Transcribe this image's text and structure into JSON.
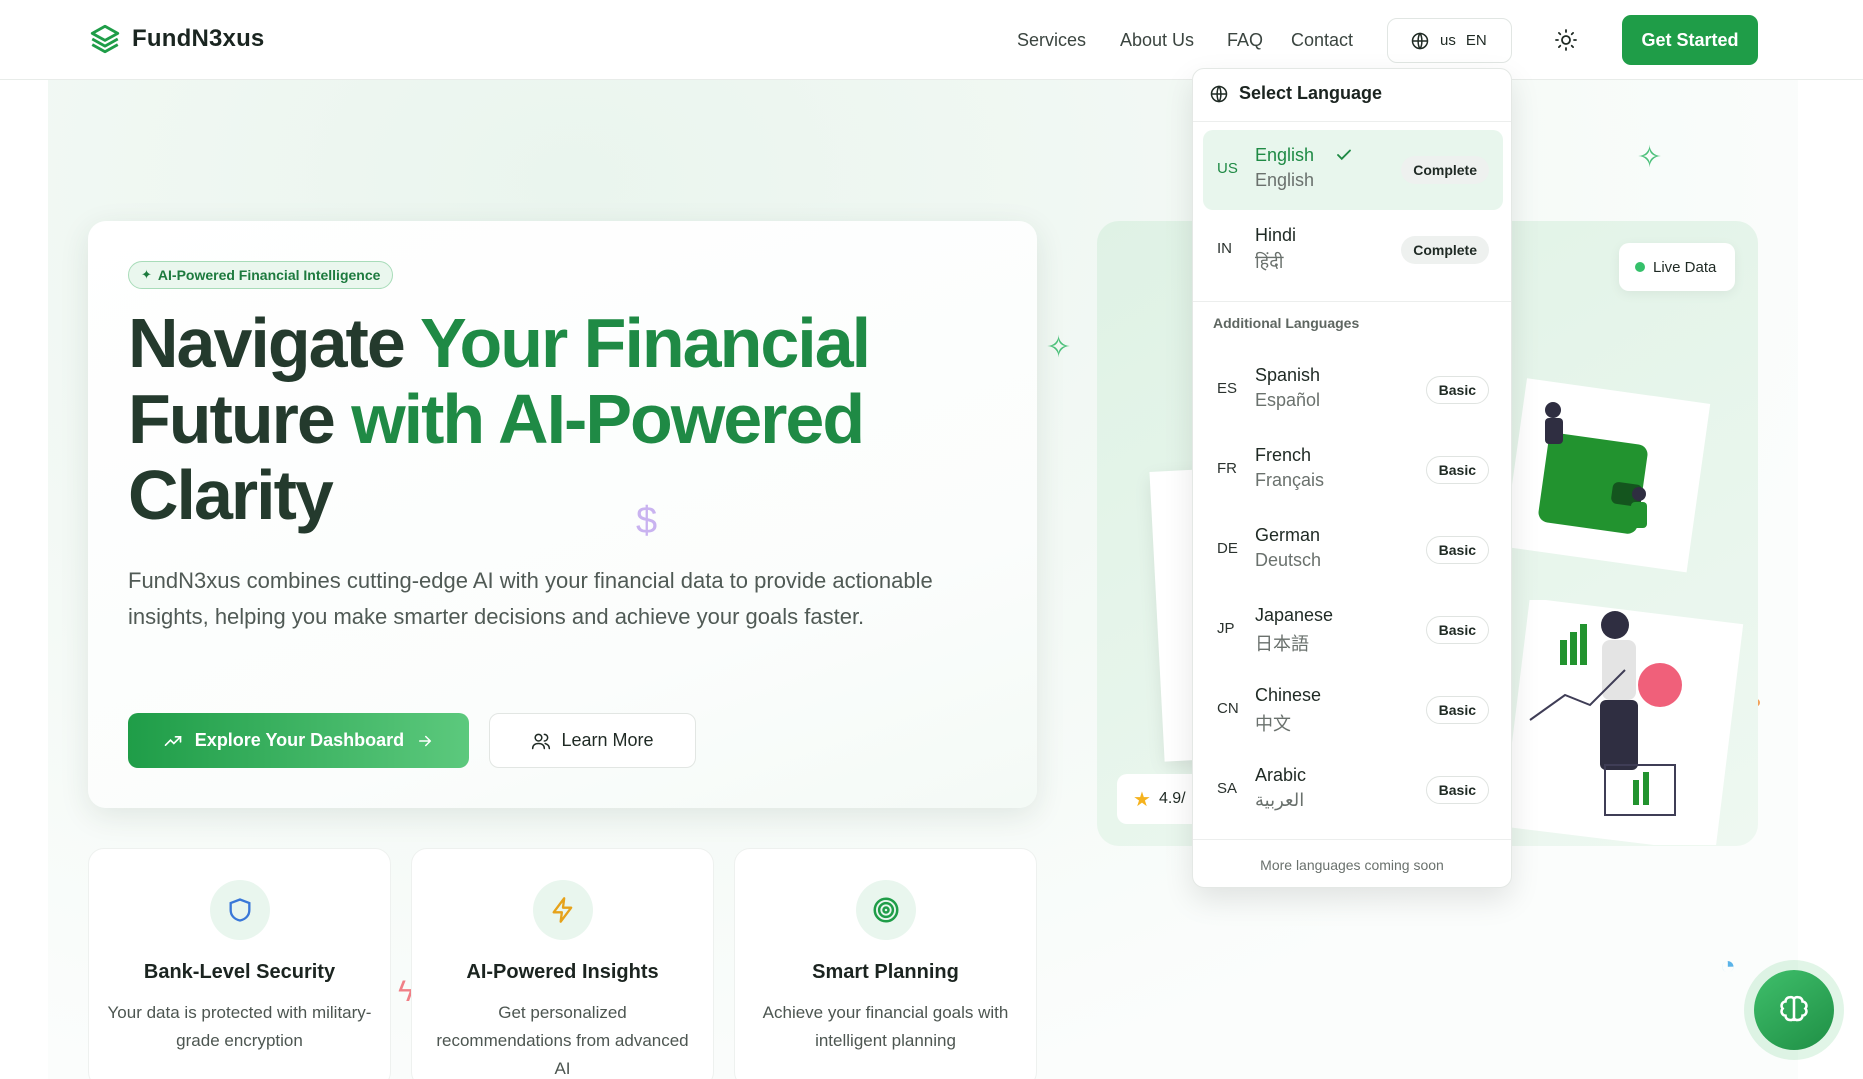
{
  "brand": {
    "name": "FundN3xus"
  },
  "nav": {
    "links": [
      "Services",
      "About Us",
      "FAQ",
      "Contact"
    ],
    "lang_flag": "us",
    "lang_code": "EN",
    "cta": "Get Started"
  },
  "hero": {
    "badge": "AI-Powered Financial Intelligence",
    "headline_parts": [
      "Navigate ",
      "Your Financial",
      "Future ",
      "with AI-Powered",
      "Clarity"
    ],
    "description": "FundN3xus combines cutting-edge AI with your financial data to provide actionable insights, helping you make smarter decisions and achieve your goals faster.",
    "primary_button": "Explore Your Dashboard",
    "secondary_button": "Learn More"
  },
  "features": [
    {
      "title": "Bank-Level Security",
      "desc": "Your data is protected with military-grade encryption",
      "icon": "shield-icon"
    },
    {
      "title": "AI-Powered Insights",
      "desc": "Get personalized recommendations from advanced AI",
      "icon": "lightning-icon"
    },
    {
      "title": "Smart Planning",
      "desc": "Achieve your financial goals with intelligent planning",
      "icon": "target-icon"
    }
  ],
  "illustration": {
    "live_label": "Live Data",
    "rating": "4.9/"
  },
  "language_menu": {
    "title": "Select Language",
    "complete": [
      {
        "code": "US",
        "name": "English",
        "native": "English",
        "tag": "Complete",
        "active": true
      },
      {
        "code": "IN",
        "name": "Hindi",
        "native": "हिंदी",
        "tag": "Complete",
        "active": false
      }
    ],
    "additional_label": "Additional Languages",
    "additional": [
      {
        "code": "ES",
        "name": "Spanish",
        "native": "Español",
        "tag": "Basic"
      },
      {
        "code": "FR",
        "name": "French",
        "native": "Français",
        "tag": "Basic"
      },
      {
        "code": "DE",
        "name": "German",
        "native": "Deutsch",
        "tag": "Basic"
      },
      {
        "code": "JP",
        "name": "Japanese",
        "native": "日本語",
        "tag": "Basic"
      },
      {
        "code": "CN",
        "name": "Chinese",
        "native": "中文",
        "tag": "Basic"
      },
      {
        "code": "SA",
        "name": "Arabic",
        "native": "العربية",
        "tag": "Basic"
      }
    ],
    "footer": "More languages coming soon"
  },
  "colors": {
    "brand_green": "#1f9d48",
    "dark_heading": "#243a2d",
    "accent_green": "#1f8a45"
  }
}
